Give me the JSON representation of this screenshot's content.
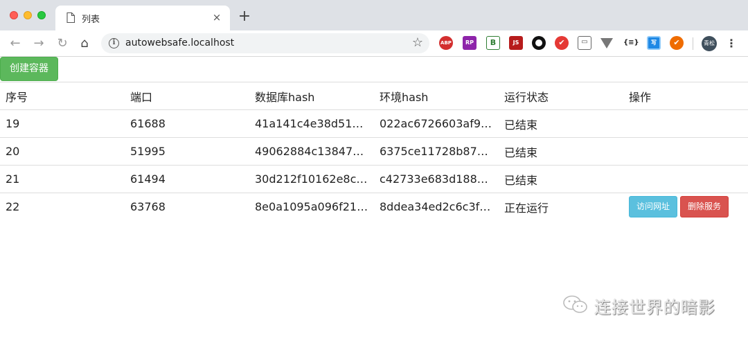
{
  "browser": {
    "tab_title": "列表",
    "tab_close": "×",
    "new_tab": "+",
    "url": "autowebsafe.localhost",
    "extensions": {
      "abp": "ABP",
      "rp": "RP",
      "green": "B",
      "js": "JS",
      "json": "{≡}",
      "blue": "写"
    },
    "profile": "青松",
    "menu": "⋮"
  },
  "toolbar_icons": {
    "back": "←",
    "forward": "→",
    "reload": "↻",
    "home": "⌂",
    "info": "i",
    "star": "☆"
  },
  "page": {
    "create_button": "创建容器",
    "table": {
      "headers": [
        "序号",
        "端口",
        "数据库hash",
        "环境hash",
        "运行状态",
        "操作"
      ],
      "rows": [
        [
          "19",
          "61688",
          "41a141c4e38d514…",
          "022ac6726603af9e…",
          "已结束"
        ],
        [
          "20",
          "51995",
          "49062884c138470…",
          "6375ce11728b874…",
          "已结束"
        ],
        [
          "21",
          "61494",
          "30d212f10162e8ce…",
          "c42733e683d1888f…",
          "已结束"
        ],
        [
          "22",
          "63768",
          "8e0a1095a096f218…",
          "8ddea34ed2c6c3f2…",
          "正在运行"
        ]
      ],
      "actions": {
        "visit": "访问网址",
        "delete": "删除服务"
      }
    },
    "watermark": "连接世界的暗影"
  },
  "colors": {
    "success": "#5cb85c",
    "info": "#5bc0de",
    "danger": "#d9534f"
  }
}
